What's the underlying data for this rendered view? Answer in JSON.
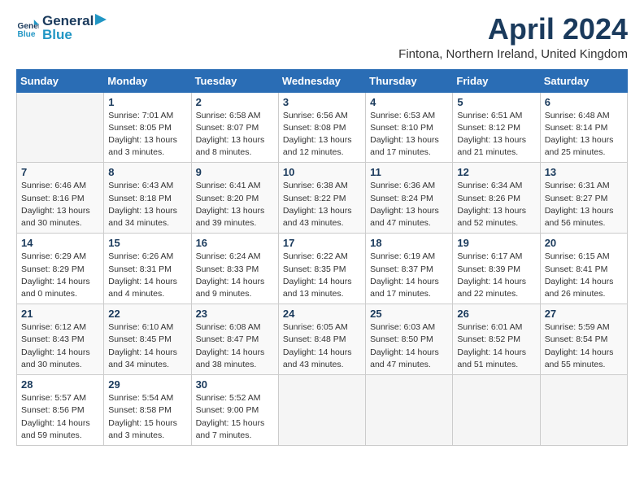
{
  "logo": {
    "line1": "General",
    "line2": "Blue"
  },
  "title": "April 2024",
  "subtitle": "Fintona, Northern Ireland, United Kingdom",
  "headers": [
    "Sunday",
    "Monday",
    "Tuesday",
    "Wednesday",
    "Thursday",
    "Friday",
    "Saturday"
  ],
  "weeks": [
    [
      {
        "day": "",
        "detail": ""
      },
      {
        "day": "1",
        "detail": "Sunrise: 7:01 AM\nSunset: 8:05 PM\nDaylight: 13 hours\nand 3 minutes."
      },
      {
        "day": "2",
        "detail": "Sunrise: 6:58 AM\nSunset: 8:07 PM\nDaylight: 13 hours\nand 8 minutes."
      },
      {
        "day": "3",
        "detail": "Sunrise: 6:56 AM\nSunset: 8:08 PM\nDaylight: 13 hours\nand 12 minutes."
      },
      {
        "day": "4",
        "detail": "Sunrise: 6:53 AM\nSunset: 8:10 PM\nDaylight: 13 hours\nand 17 minutes."
      },
      {
        "day": "5",
        "detail": "Sunrise: 6:51 AM\nSunset: 8:12 PM\nDaylight: 13 hours\nand 21 minutes."
      },
      {
        "day": "6",
        "detail": "Sunrise: 6:48 AM\nSunset: 8:14 PM\nDaylight: 13 hours\nand 25 minutes."
      }
    ],
    [
      {
        "day": "7",
        "detail": "Sunrise: 6:46 AM\nSunset: 8:16 PM\nDaylight: 13 hours\nand 30 minutes."
      },
      {
        "day": "8",
        "detail": "Sunrise: 6:43 AM\nSunset: 8:18 PM\nDaylight: 13 hours\nand 34 minutes."
      },
      {
        "day": "9",
        "detail": "Sunrise: 6:41 AM\nSunset: 8:20 PM\nDaylight: 13 hours\nand 39 minutes."
      },
      {
        "day": "10",
        "detail": "Sunrise: 6:38 AM\nSunset: 8:22 PM\nDaylight: 13 hours\nand 43 minutes."
      },
      {
        "day": "11",
        "detail": "Sunrise: 6:36 AM\nSunset: 8:24 PM\nDaylight: 13 hours\nand 47 minutes."
      },
      {
        "day": "12",
        "detail": "Sunrise: 6:34 AM\nSunset: 8:26 PM\nDaylight: 13 hours\nand 52 minutes."
      },
      {
        "day": "13",
        "detail": "Sunrise: 6:31 AM\nSunset: 8:27 PM\nDaylight: 13 hours\nand 56 minutes."
      }
    ],
    [
      {
        "day": "14",
        "detail": "Sunrise: 6:29 AM\nSunset: 8:29 PM\nDaylight: 14 hours\nand 0 minutes."
      },
      {
        "day": "15",
        "detail": "Sunrise: 6:26 AM\nSunset: 8:31 PM\nDaylight: 14 hours\nand 4 minutes."
      },
      {
        "day": "16",
        "detail": "Sunrise: 6:24 AM\nSunset: 8:33 PM\nDaylight: 14 hours\nand 9 minutes."
      },
      {
        "day": "17",
        "detail": "Sunrise: 6:22 AM\nSunset: 8:35 PM\nDaylight: 14 hours\nand 13 minutes."
      },
      {
        "day": "18",
        "detail": "Sunrise: 6:19 AM\nSunset: 8:37 PM\nDaylight: 14 hours\nand 17 minutes."
      },
      {
        "day": "19",
        "detail": "Sunrise: 6:17 AM\nSunset: 8:39 PM\nDaylight: 14 hours\nand 22 minutes."
      },
      {
        "day": "20",
        "detail": "Sunrise: 6:15 AM\nSunset: 8:41 PM\nDaylight: 14 hours\nand 26 minutes."
      }
    ],
    [
      {
        "day": "21",
        "detail": "Sunrise: 6:12 AM\nSunset: 8:43 PM\nDaylight: 14 hours\nand 30 minutes."
      },
      {
        "day": "22",
        "detail": "Sunrise: 6:10 AM\nSunset: 8:45 PM\nDaylight: 14 hours\nand 34 minutes."
      },
      {
        "day": "23",
        "detail": "Sunrise: 6:08 AM\nSunset: 8:47 PM\nDaylight: 14 hours\nand 38 minutes."
      },
      {
        "day": "24",
        "detail": "Sunrise: 6:05 AM\nSunset: 8:48 PM\nDaylight: 14 hours\nand 43 minutes."
      },
      {
        "day": "25",
        "detail": "Sunrise: 6:03 AM\nSunset: 8:50 PM\nDaylight: 14 hours\nand 47 minutes."
      },
      {
        "day": "26",
        "detail": "Sunrise: 6:01 AM\nSunset: 8:52 PM\nDaylight: 14 hours\nand 51 minutes."
      },
      {
        "day": "27",
        "detail": "Sunrise: 5:59 AM\nSunset: 8:54 PM\nDaylight: 14 hours\nand 55 minutes."
      }
    ],
    [
      {
        "day": "28",
        "detail": "Sunrise: 5:57 AM\nSunset: 8:56 PM\nDaylight: 14 hours\nand 59 minutes."
      },
      {
        "day": "29",
        "detail": "Sunrise: 5:54 AM\nSunset: 8:58 PM\nDaylight: 15 hours\nand 3 minutes."
      },
      {
        "day": "30",
        "detail": "Sunrise: 5:52 AM\nSunset: 9:00 PM\nDaylight: 15 hours\nand 7 minutes."
      },
      {
        "day": "",
        "detail": ""
      },
      {
        "day": "",
        "detail": ""
      },
      {
        "day": "",
        "detail": ""
      },
      {
        "day": "",
        "detail": ""
      }
    ]
  ]
}
